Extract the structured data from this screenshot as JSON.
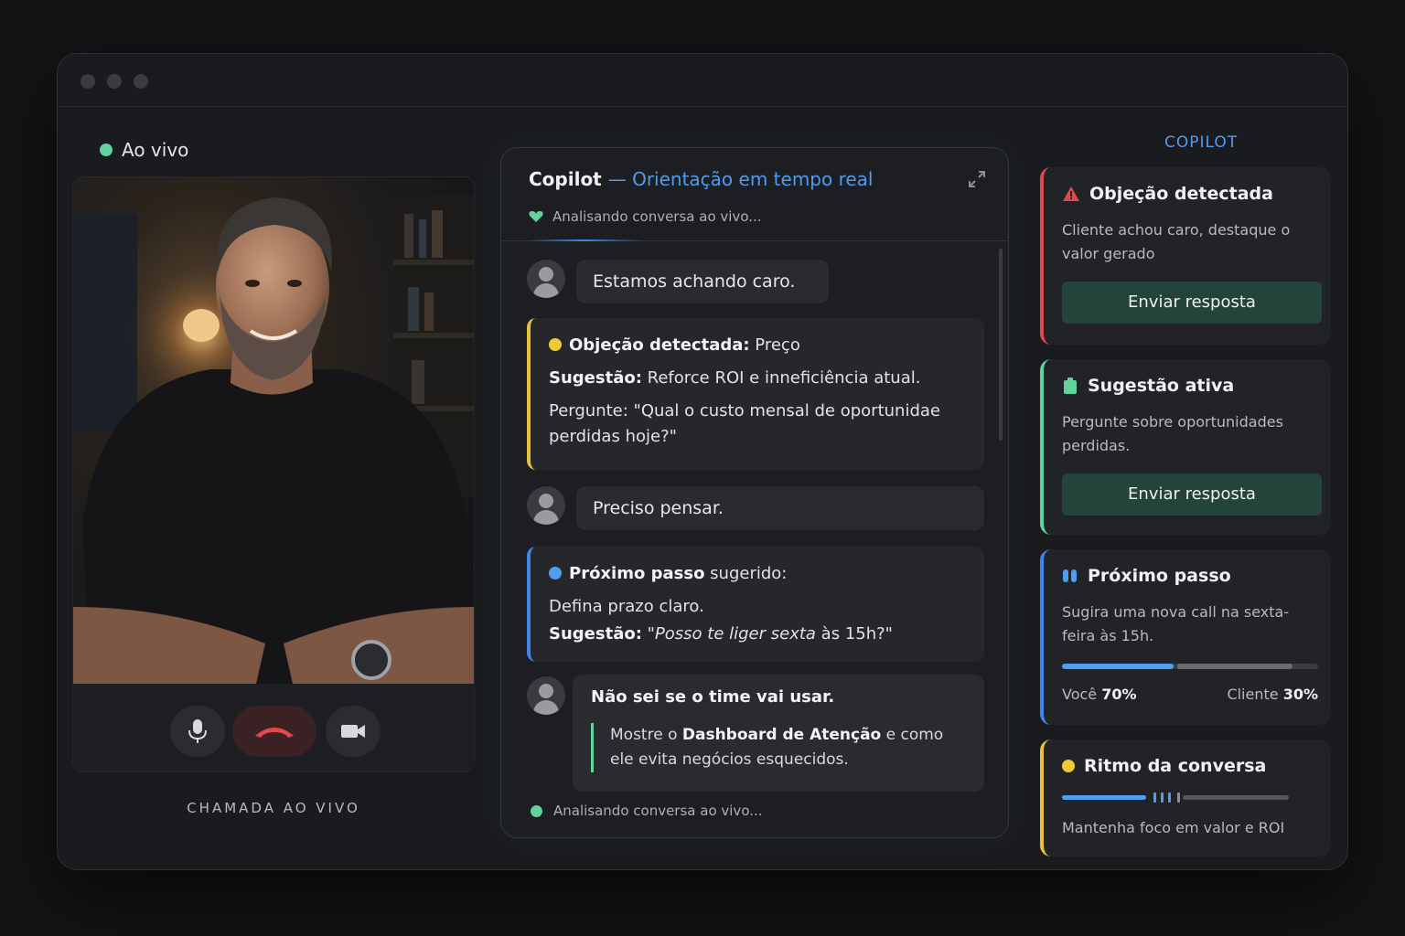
{
  "video": {
    "live_label": "Ao vivo",
    "call_label": "CHAMADA AO VIVO"
  },
  "copilot_panel": {
    "title": "Copilot",
    "subtitle": "— Orientação em tempo real",
    "status": "Analisando conversa ao vivo...",
    "messages": [
      {
        "text": "Estamos achando caro."
      },
      {
        "text": "Preciso pensar."
      },
      {
        "text": "Não sei se o time vai usar."
      }
    ],
    "card1": {
      "title": "Objeção detectada:",
      "value": " Preço",
      "suggestion_label": "Sugestão:",
      "suggestion_text": " Reforce ROI e inneficiência atual.",
      "ask_label": "Pergunte:",
      "ask_text": " \"Qual o custo mensal de oportunidae perdidas hoje?\""
    },
    "card2": {
      "title": "Próximo passo",
      "title_rest": " sugerido:",
      "line": "Defina prazo claro.",
      "suggestion_label": "Sugestão:",
      "suggestion_text": "\"Posso te liger sexta",
      "suggestion_tail": " às 15h?\""
    },
    "reply": {
      "pre": "Mostre o ",
      "highlight": "Dashboard de Atenção",
      "post": " e como ele evita negócios esquecidos."
    },
    "footer_status": "Analisando conversa ao vivo..."
  },
  "sidebar": {
    "title": "COPILOT",
    "objection": {
      "title": "Objeção detectada",
      "body": "Cliente achou caro, destaque o valor gerado",
      "button": "Enviar resposta"
    },
    "suggestion": {
      "title": "Sugestão ativa",
      "body": "Pergunte sobre oportunidades perdidas.",
      "button": "Enviar resposta"
    },
    "next_step": {
      "title": "Próximo passo",
      "body": "Sugira uma nova call na sexta-feira às 15h.",
      "you_label": "Você",
      "you_value": "70%",
      "client_label": "Cliente",
      "client_value": "30%",
      "you_fraction": 0.7,
      "client_fraction": 0.3
    },
    "rhythm": {
      "title": "Ritmo da conversa",
      "body": "Mantenha foco em valor e ROI"
    }
  },
  "colors": {
    "accent_blue": "#4f9cf0",
    "live_green": "#5fd39b",
    "alert_red": "#e0474f",
    "warn_yellow": "#e6c23a",
    "button_green": "#24433a"
  }
}
